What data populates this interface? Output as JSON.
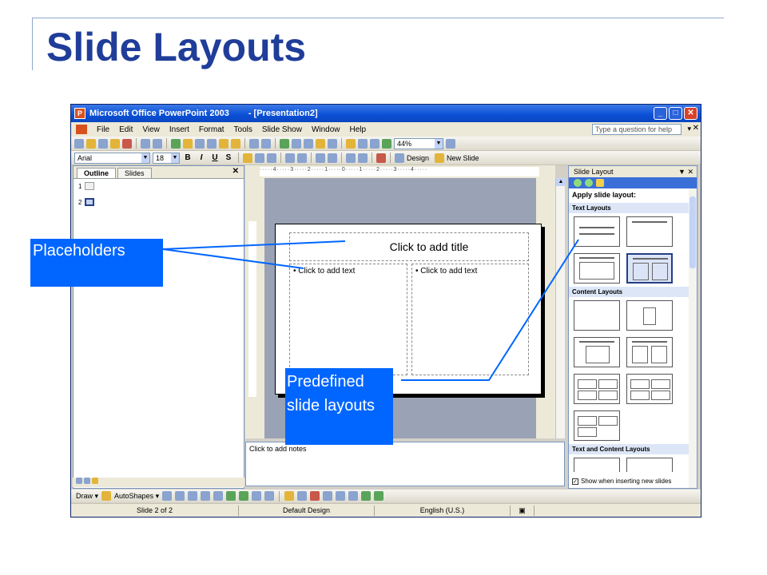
{
  "slide": {
    "title": "Slide Layouts"
  },
  "window": {
    "title_app": "Microsoft Office PowerPoint 2003",
    "title_doc": "- [Presentation2]",
    "buttons": {
      "minimize": "_",
      "maximize": "□",
      "close": "✕"
    }
  },
  "menubar": {
    "items": [
      "File",
      "Edit",
      "View",
      "Insert",
      "Format",
      "Tools",
      "Slide Show",
      "Window",
      "Help"
    ],
    "help_placeholder": "Type a question for help",
    "close_doc": "✕"
  },
  "toolbar": {
    "zoom": "44%",
    "font_name": "Arial",
    "font_size": "18",
    "bold": "B",
    "italic": "I",
    "underline": "U",
    "shadow": "S",
    "design_label": "Design",
    "new_slide_label": "New Slide"
  },
  "outline_pane": {
    "tabs": [
      "Outline",
      "Slides"
    ],
    "close": "✕",
    "slides": [
      {
        "number": "1"
      },
      {
        "number": "2"
      }
    ]
  },
  "slide_canvas": {
    "title_placeholder": "Click to add title",
    "left_text": "•  Click to add text",
    "right_text": "•  Click to add text"
  },
  "notes": {
    "placeholder": "Click to add notes"
  },
  "task_pane": {
    "title": "Slide Layout",
    "controls": "▼  ✕",
    "apply_label": "Apply slide layout:",
    "sections": [
      "Text Layouts",
      "Content Layouts",
      "Text and Content Layouts"
    ],
    "show_checkbox_label": "Show when inserting new slides",
    "show_checkbox_checked": true
  },
  "drawing_toolbar": {
    "draw_label": "Draw ▾",
    "autoshapes_label": "AutoShapes ▾"
  },
  "statusbar": {
    "slide_info": "Slide 2 of 2",
    "design": "Default Design",
    "language": "English (U.S.)"
  },
  "callouts": {
    "placeholders": "Placeholders",
    "predefined_line1": "Predefined",
    "predefined_line2": "slide layouts"
  },
  "colors": {
    "title": "#1f3d99",
    "callout_bg": "#0066ff",
    "callout_text": "#ffffff",
    "connector": "#0066ff"
  }
}
